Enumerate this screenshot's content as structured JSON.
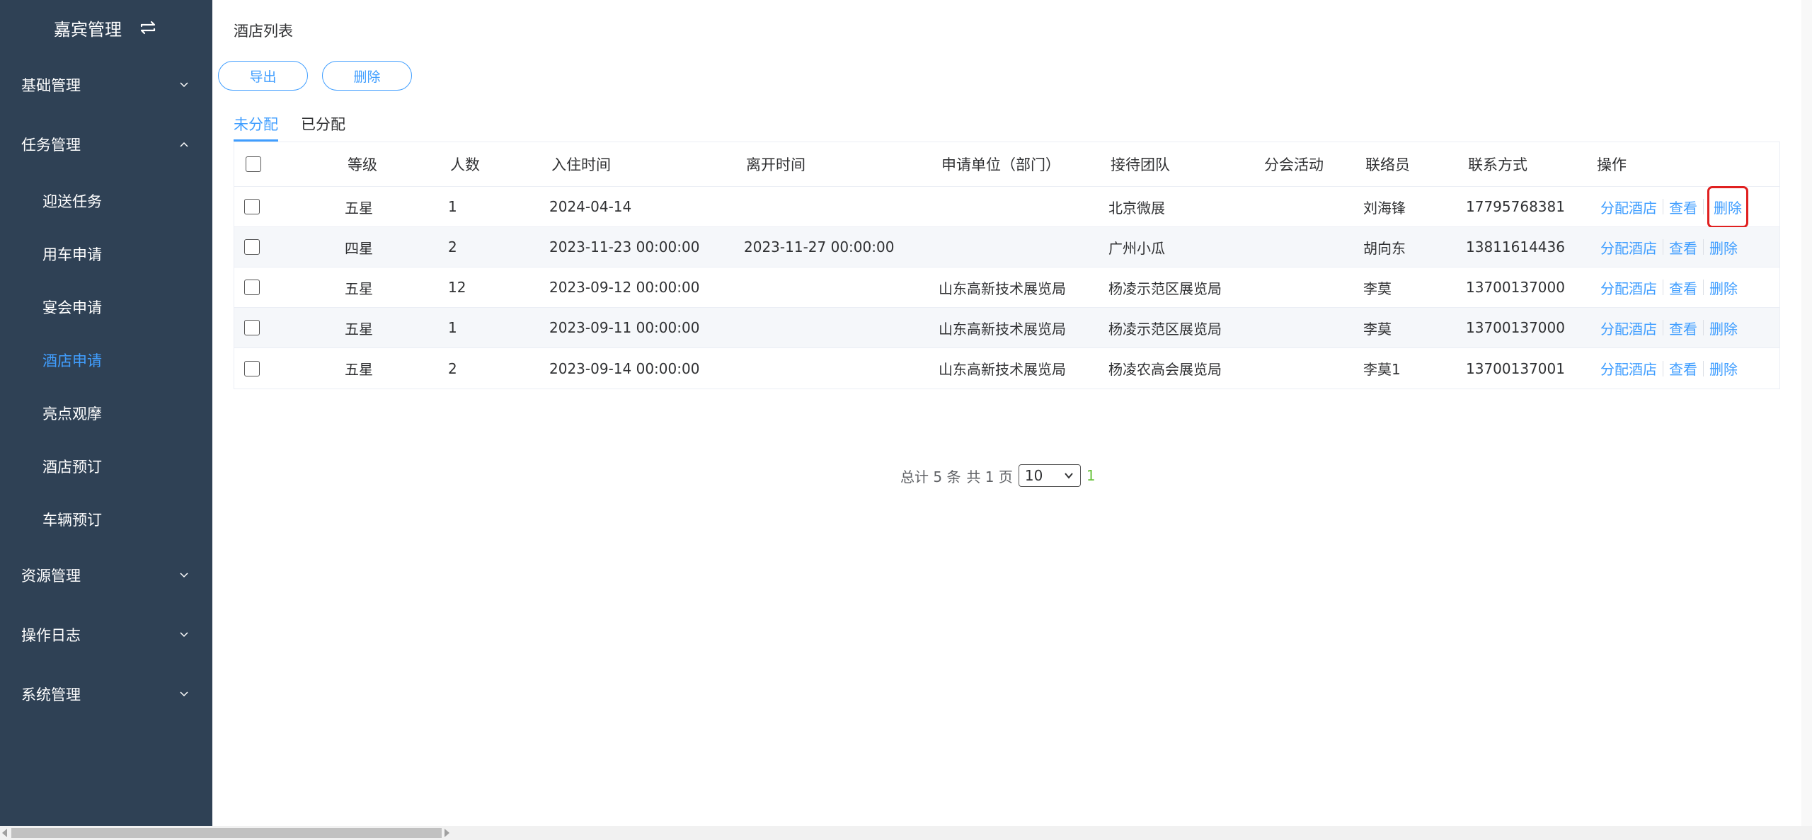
{
  "sidebar": {
    "title": "嘉宾管理",
    "toggle_icon": "swap-icon",
    "groups": [
      {
        "label": "基础管理",
        "expanded": false
      },
      {
        "label": "任务管理",
        "expanded": true,
        "items": [
          "迎送任务",
          "用车申请",
          "宴会申请",
          "酒店申请",
          "亮点观摩",
          "酒店预订",
          "车辆预订"
        ],
        "active": "酒店申请"
      },
      {
        "label": "资源管理",
        "expanded": false
      },
      {
        "label": "操作日志",
        "expanded": false
      },
      {
        "label": "系统管理",
        "expanded": false
      }
    ]
  },
  "page": {
    "title": "酒店列表",
    "export_label": "导出",
    "delete_label": "删除",
    "tabs": [
      "未分配",
      "已分配"
    ],
    "active_tab": "未分配"
  },
  "table": {
    "headers": [
      "等级",
      "人数",
      "入住时间",
      "离开时间",
      "申请单位（部门）",
      "接待团队",
      "分会活动",
      "联络员",
      "联系方式",
      "操作"
    ],
    "rows": [
      [
        "五星",
        "1",
        "2024-04-14",
        "",
        "",
        "北京微展",
        "",
        "刘海锋",
        "17795768381"
      ],
      [
        "四星",
        "2",
        "2023-11-23 00:00:00",
        "2023-11-27 00:00:00",
        "",
        "广州小瓜",
        "",
        "胡向东",
        "13811614436"
      ],
      [
        "五星",
        "12",
        "2023-09-12 00:00:00",
        "",
        "山东高新技术展览局",
        "杨凌示范区展览局",
        "",
        "李莫",
        "13700137000"
      ],
      [
        "五星",
        "1",
        "2023-09-11 00:00:00",
        "",
        "山东高新技术展览局",
        "杨凌示范区展览局",
        "",
        "李莫",
        "13700137000"
      ],
      [
        "五星",
        "2",
        "2023-09-14 00:00:00",
        "",
        "山东高新技术展览局",
        "杨凌农高会展览局",
        "",
        "李莫1",
        "13700137001"
      ]
    ],
    "actions": [
      "分配酒店",
      "查看",
      "删除"
    ],
    "highlighted_action": {
      "row": 1,
      "action": "删除"
    }
  },
  "pagination": {
    "total_text": "总计 5 条",
    "pages_text": "共 1 页",
    "page_size": "10",
    "current_page": "1"
  },
  "colors": {
    "sidebar_bg": "#2f4155",
    "accent": "#409eff",
    "highlight": "#e02020",
    "page_number": "#67c23a"
  }
}
